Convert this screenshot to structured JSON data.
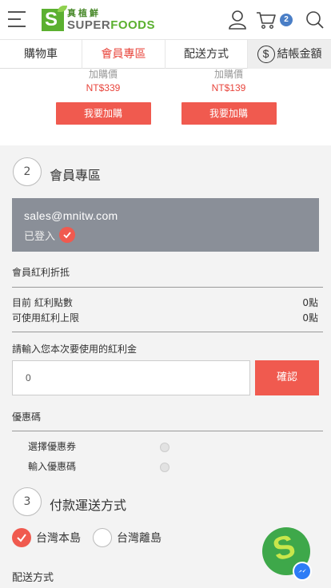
{
  "header": {
    "logo_cn": "真植鮮",
    "logo_en_super": "SUPER",
    "logo_en_foods": "FOODS",
    "cart_count": "2"
  },
  "tabs": [
    {
      "label": "購物車"
    },
    {
      "label": "會員專區"
    },
    {
      "label": "配送方式"
    },
    {
      "label": "結帳金額",
      "icon": "dollar-icon"
    }
  ],
  "addons": [
    {
      "label": "加購價",
      "price": "NT$339",
      "button": "我要加購"
    },
    {
      "label": "加購價",
      "price": "NT$139",
      "button": "我要加購"
    }
  ],
  "member": {
    "step": "2",
    "title": "會員專區",
    "email": "sales@mnitw.com",
    "status": "已登入"
  },
  "bonus": {
    "section_title": "會員紅利折抵",
    "current_label": "目前 紅利點數",
    "current_value": "0點",
    "limit_label": "可使用紅利上限",
    "limit_value": "0點",
    "input_prompt": "請輸入您本次要使用的紅利金",
    "input_value": "0",
    "confirm": "確認"
  },
  "coupon": {
    "title": "優惠碼",
    "options": [
      "選擇優惠券",
      "輸入優惠碼"
    ]
  },
  "payment": {
    "step": "3",
    "title": "付款運送方式",
    "options": [
      {
        "label": "台灣本島",
        "selected": true
      },
      {
        "label": "台灣離島",
        "selected": false
      }
    ],
    "delivery_title": "配送方式"
  },
  "colors": {
    "accent": "#f05a4f",
    "brand_green": "#5bb030",
    "badge_blue": "#4a7ec6",
    "login_box": "#8a8f98"
  }
}
